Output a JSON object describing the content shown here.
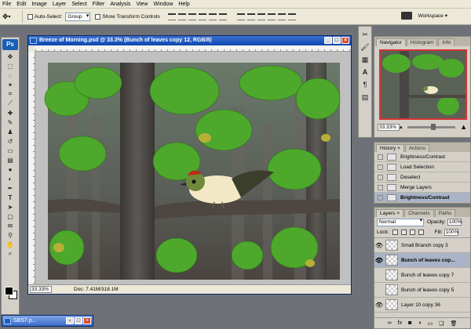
{
  "menu": [
    "File",
    "Edit",
    "Image",
    "Layer",
    "Select",
    "Filter",
    "Analysis",
    "View",
    "Window",
    "Help"
  ],
  "options": {
    "auto_select_label": "Auto-Select:",
    "auto_select_value": "Group",
    "show_transform_label": "Show Transform Controls",
    "workspace_label": "Workspace ▾"
  },
  "document": {
    "title": "Breeze of Morning.psd @ 33.3% (Bunch of leaves copy 12, RGB/8)",
    "zoom": "33.33%",
    "doc_info": "Doc: 7.41M/318.1M"
  },
  "navigator": {
    "tabs": [
      "Navigator",
      "Histogram",
      "Info"
    ],
    "zoom": "33.33%"
  },
  "history": {
    "tabs": [
      "History",
      "Actions"
    ],
    "items": [
      {
        "label": "Brightness/Contrast",
        "selected": false
      },
      {
        "label": "Load Selection",
        "selected": false
      },
      {
        "label": "Deselect",
        "selected": false
      },
      {
        "label": "Merge Layers",
        "selected": false
      },
      {
        "label": "Brightness/Contrast",
        "selected": true
      }
    ]
  },
  "layers": {
    "tabs": [
      "Layers",
      "Channels",
      "Paths"
    ],
    "blend_mode": "Normal",
    "opacity_label": "Opacity:",
    "opacity": "100%",
    "lock_label": "Lock:",
    "fill_label": "Fill:",
    "fill": "100%",
    "items": [
      {
        "name": "Small Branch copy 3",
        "visible": true,
        "selected": false
      },
      {
        "name": "Bunch of leaves cop...",
        "visible": true,
        "selected": true
      },
      {
        "name": "Bunch of leaves copy 7",
        "visible": false,
        "selected": false
      },
      {
        "name": "Bunch of leaves copy 5",
        "visible": false,
        "selected": false
      },
      {
        "name": "Layer 10 copy 36",
        "visible": true,
        "selected": false
      }
    ]
  },
  "minimized_doc": {
    "title": "SBS7.p..."
  },
  "colors": {
    "accent_blue": "#0c47b0",
    "selection": "#aab4c8",
    "panel_bg": "#d4d0c8",
    "close_red": "#d94a2c"
  }
}
